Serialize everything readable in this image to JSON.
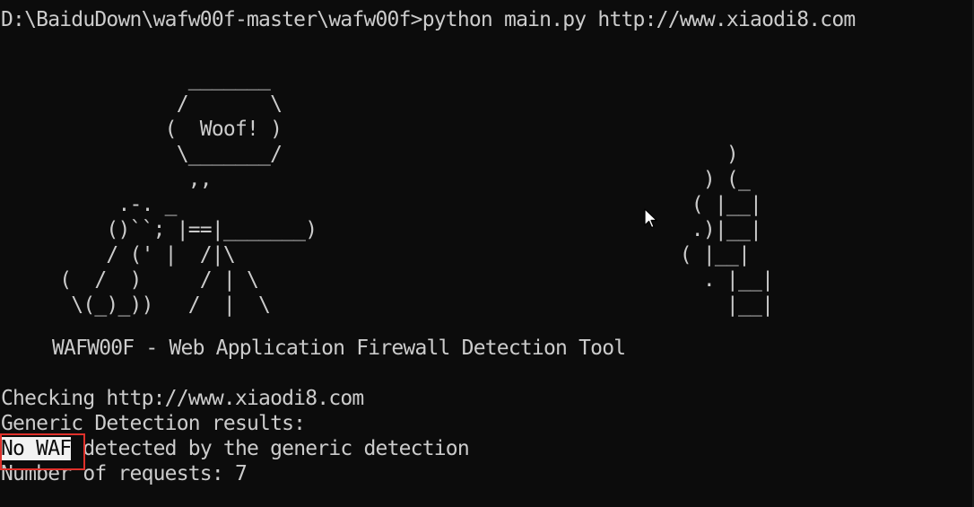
{
  "terminal": {
    "prompt_line": "D:\\BaiduDown\\wafw00f-master\\wafw00f>python main.py http://www.xiaodi8.com",
    "ascii_art": [
      "                _______",
      "               /       \\",
      "              (  Woof! )",
      "               \\_______/                                      )",
      "                ,,                                          ) (_",
      "          .-. _                                            ( |__|",
      "         ()``; |==|_______)                                .)|__|",
      "         / (' |  /|\\                                      ( |__|",
      "     (  /  )     / | \\                                      . |__|",
      "      \\(_)_))   /  |  \\                                       |__|"
    ],
    "banner_title": "WAFW00F - Web Application Firewall Detection Tool",
    "checking_line": "Checking http://www.xiaodi8.com",
    "generic_results_line": "Generic Detection results:",
    "highlight_text": "No WAF",
    "detected_rest": " detected by the generic detection",
    "requests_line": "Number of requests: 7"
  },
  "colors": {
    "background": "#0c0c0c",
    "foreground": "#cccccc",
    "selection_bg": "#f2f2f2",
    "annotation_box": "#e0312b"
  },
  "icons": {
    "pointer": "mouse-pointer-icon"
  }
}
